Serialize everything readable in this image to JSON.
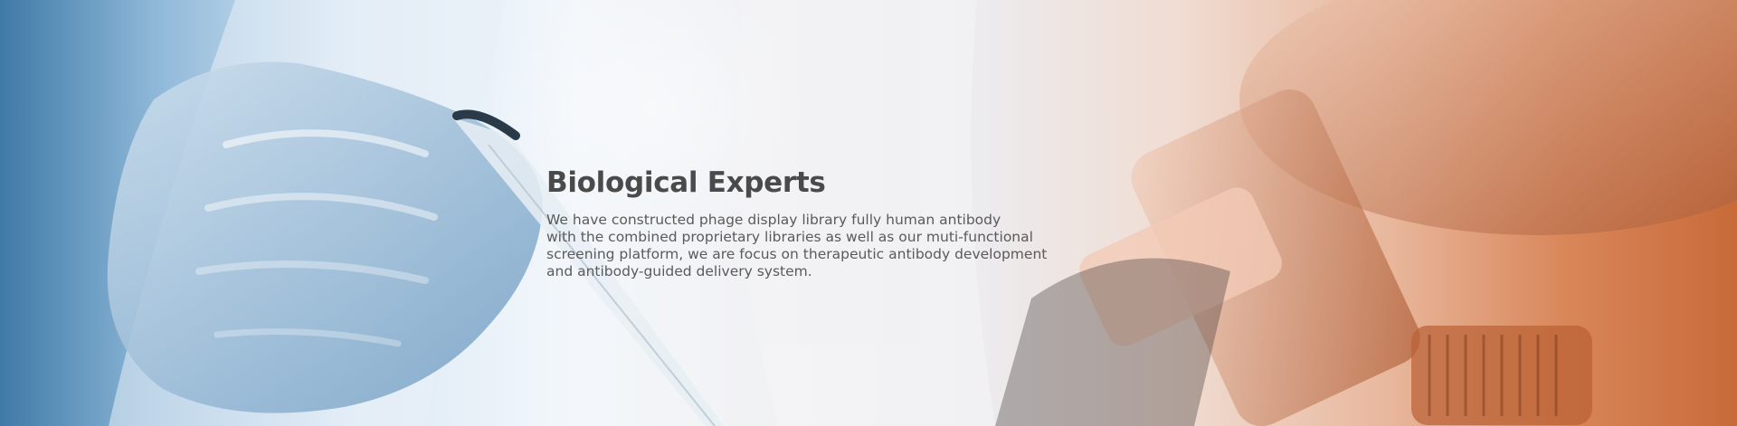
{
  "hero": {
    "title": "Biological Experts",
    "lines": [
      "We have constructed phage display library fully human antibody",
      "with the combined proprietary libraries as well as our muti-functional",
      "screening platform, we are focus on therapeutic antibody development",
      "and antibody-guided delivery system."
    ]
  },
  "colors": {
    "left_tint": "#3f7aa6",
    "right_tint": "#c86a3a",
    "title_text": "#4a4a4a",
    "body_text": "#5a5a5a"
  }
}
